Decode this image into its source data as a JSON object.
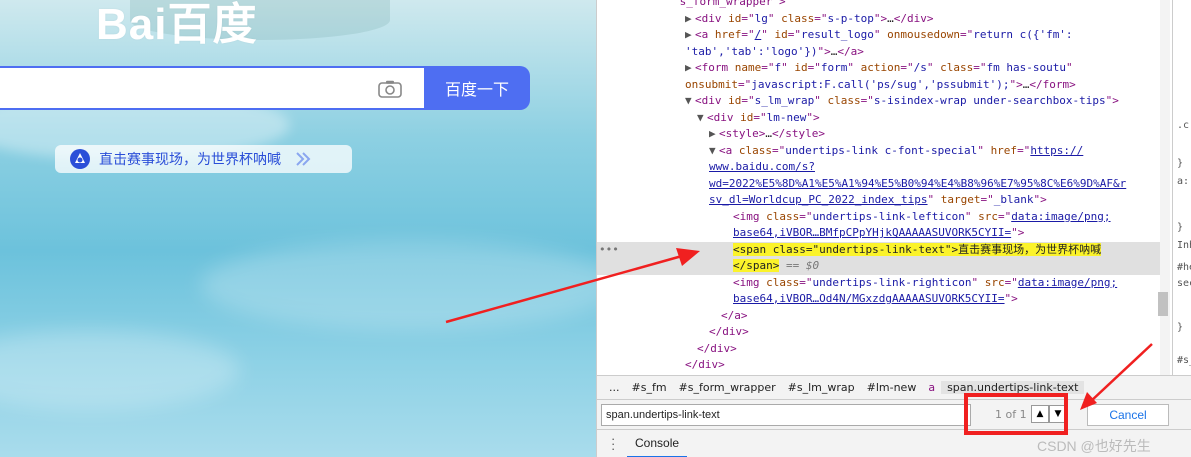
{
  "baidu": {
    "logo": "Bai百度",
    "search_button": "百度一下",
    "tips_text": "直击赛事现场，为世界杯呐喊"
  },
  "dom_lines": [
    {
      "parts": [
        [
          "tag",
          "\"s_form_wrapper\">"
        ]
      ]
    },
    {
      "parts": [
        [
          "tri",
          "▶"
        ],
        [
          "tag",
          "<div "
        ],
        [
          "attr",
          "id"
        ],
        [
          "tag",
          "=\""
        ],
        [
          "val",
          "lg"
        ],
        [
          "tag",
          "\" "
        ],
        [
          "attr",
          "class"
        ],
        [
          "tag",
          "=\""
        ],
        [
          "val",
          "s-p-top"
        ],
        [
          "tag",
          "\">"
        ],
        [
          "txt",
          "…"
        ],
        [
          "tag",
          "</div>"
        ]
      ]
    },
    {
      "parts": [
        [
          "tri",
          "▶"
        ],
        [
          "tag",
          "<a "
        ],
        [
          "attr",
          "href"
        ],
        [
          "tag",
          "=\""
        ],
        [
          "lnk",
          "/"
        ],
        [
          "tag",
          "\" "
        ],
        [
          "attr",
          "id"
        ],
        [
          "tag",
          "=\""
        ],
        [
          "val",
          "result_logo"
        ],
        [
          "tag",
          "\" "
        ],
        [
          "attr",
          "onmousedown"
        ],
        [
          "tag",
          "=\""
        ],
        [
          "val",
          "return c({'fm':"
        ]
      ]
    },
    {
      "parts": [
        [
          "val",
          "'tab','tab':'logo'})"
        ],
        [
          "tag",
          "\">"
        ],
        [
          "txt",
          "…"
        ],
        [
          "tag",
          "</a>"
        ]
      ]
    },
    {
      "parts": [
        [
          "tri",
          "▶"
        ],
        [
          "tag",
          "<form "
        ],
        [
          "attr",
          "name"
        ],
        [
          "tag",
          "=\""
        ],
        [
          "val",
          "f"
        ],
        [
          "tag",
          "\" "
        ],
        [
          "attr",
          "id"
        ],
        [
          "tag",
          "=\""
        ],
        [
          "val",
          "form"
        ],
        [
          "tag",
          "\" "
        ],
        [
          "attr",
          "action"
        ],
        [
          "tag",
          "=\""
        ],
        [
          "val",
          "/s"
        ],
        [
          "tag",
          "\" "
        ],
        [
          "attr",
          "class"
        ],
        [
          "tag",
          "=\""
        ],
        [
          "val",
          "fm  has-soutu"
        ],
        [
          "tag",
          "\""
        ]
      ]
    },
    {
      "parts": [
        [
          "attr",
          "onsubmit"
        ],
        [
          "tag",
          "=\""
        ],
        [
          "val",
          "javascript:F.call('ps/sug','pssubmit');"
        ],
        [
          "tag",
          "\">"
        ],
        [
          "txt",
          "…"
        ],
        [
          "tag",
          "</form>"
        ]
      ]
    },
    {
      "parts": [
        [
          "tri",
          "▼"
        ],
        [
          "tag",
          "<div "
        ],
        [
          "attr",
          "id"
        ],
        [
          "tag",
          "=\""
        ],
        [
          "val",
          "s_lm_wrap"
        ],
        [
          "tag",
          "\" "
        ],
        [
          "attr",
          "class"
        ],
        [
          "tag",
          "=\""
        ],
        [
          "val",
          "s-isindex-wrap under-searchbox-tips"
        ],
        [
          "tag",
          "\">"
        ]
      ]
    },
    {
      "parts": [
        [
          "tri",
          "▼"
        ],
        [
          "tag",
          "<div "
        ],
        [
          "attr",
          "id"
        ],
        [
          "tag",
          "=\""
        ],
        [
          "val",
          "lm-new"
        ],
        [
          "tag",
          "\">"
        ]
      ]
    },
    {
      "parts": [
        [
          "tri",
          "▶"
        ],
        [
          "tag",
          "<style>"
        ],
        [
          "txt",
          "…"
        ],
        [
          "tag",
          "</style>"
        ]
      ]
    },
    {
      "parts": [
        [
          "tri",
          "▼"
        ],
        [
          "tag",
          "<a "
        ],
        [
          "attr",
          "class"
        ],
        [
          "tag",
          "=\""
        ],
        [
          "val",
          "undertips-link c-font-special"
        ],
        [
          "tag",
          "\" "
        ],
        [
          "attr",
          "href"
        ],
        [
          "tag",
          "=\""
        ],
        [
          "lnk",
          "https://"
        ]
      ]
    },
    {
      "parts": [
        [
          "lnk",
          "www.baidu.com/s?"
        ]
      ]
    },
    {
      "parts": [
        [
          "lnk",
          "wd=2022%E5%8D%A1%E5%A1%94%E5%B0%94%E4%B8%96%E7%95%8C%E6%9D%AF&r"
        ]
      ]
    },
    {
      "parts": [
        [
          "lnk",
          "sv_dl=Worldcup_PC_2022_index_tips"
        ],
        [
          "tag",
          "\" "
        ],
        [
          "attr",
          "target"
        ],
        [
          "tag",
          "=\""
        ],
        [
          "val",
          "_blank"
        ],
        [
          "tag",
          "\">"
        ]
      ]
    },
    {
      "parts": [
        [
          "tag",
          "<img "
        ],
        [
          "attr",
          "class"
        ],
        [
          "tag",
          "=\""
        ],
        [
          "val",
          "undertips-link-lefticon"
        ],
        [
          "tag",
          "\" "
        ],
        [
          "attr",
          "src"
        ],
        [
          "tag",
          "=\""
        ],
        [
          "lnk",
          "data:image/png;"
        ]
      ]
    },
    {
      "parts": [
        [
          "lnk",
          "base64,iVBOR…BMfpCPpYHjkQAAAAASUVORK5CYII="
        ],
        [
          "tag",
          "\">"
        ]
      ]
    },
    {
      "parts": [
        [
          "yel",
          "<span class=\"undertips-link-text\">直击赛事现场，为世界杯呐喊"
        ]
      ]
    },
    {
      "parts": [
        [
          "yel",
          "</span>"
        ],
        [
          "gray",
          " == $0"
        ]
      ]
    },
    {
      "parts": [
        [
          "tag",
          "<img "
        ],
        [
          "attr",
          "class"
        ],
        [
          "tag",
          "=\""
        ],
        [
          "val",
          "undertips-link-righticon"
        ],
        [
          "tag",
          "\" "
        ],
        [
          "attr",
          "src"
        ],
        [
          "tag",
          "=\""
        ],
        [
          "lnk",
          "data:image/png;"
        ]
      ]
    },
    {
      "parts": [
        [
          "lnk",
          "base64,iVBOR…Od4N/MGxzdgAAAAASUVORK5CYII="
        ],
        [
          "tag",
          "\">"
        ]
      ]
    },
    {
      "parts": [
        [
          "tag",
          "</a>"
        ]
      ]
    },
    {
      "parts": [
        [
          "tag",
          "</div>"
        ]
      ]
    },
    {
      "parts": [
        [
          "tag",
          "</div>"
        ]
      ]
    },
    {
      "parts": [
        [
          "tag",
          "</div>"
        ]
      ]
    }
  ],
  "styles_strip": [
    ".c",
    "}",
    "a:",
    "}",
    "Inh",
    "#he",
    "sec",
    "}",
    "#s_"
  ],
  "breadcrumbs": [
    "...",
    "#s_fm",
    "#s_form_wrapper",
    "#s_lm_wrap",
    "#lm-new",
    "a",
    "span.undertips-link-text"
  ],
  "find": {
    "query": "span.undertips-link-text",
    "match_count": "1 of 1",
    "up": "▲",
    "down": "▼",
    "cancel": "Cancel"
  },
  "drawer": {
    "tab": "Console",
    "watermark": "CSDN @也好先生"
  },
  "colors": {
    "baidu_blue": "#4e6ef2",
    "highlight_yellow": "#fbf32a",
    "annotation_red": "#f02020"
  }
}
